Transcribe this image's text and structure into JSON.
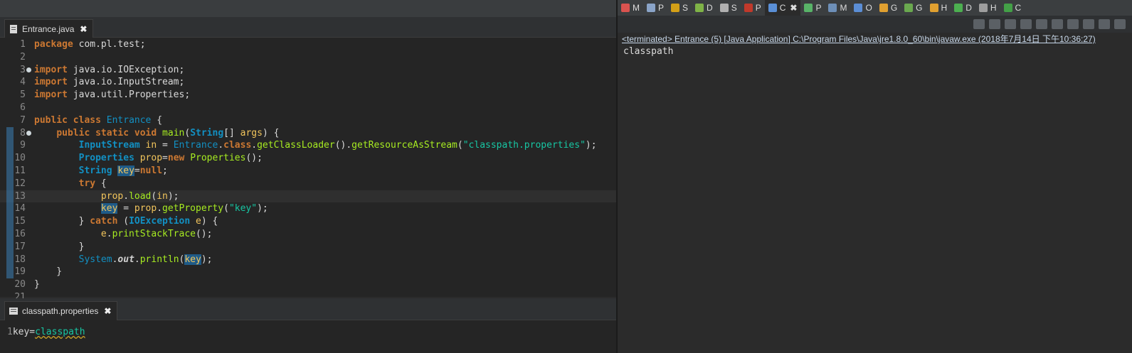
{
  "editor": {
    "tab_label": "Entrance.java",
    "lines": [
      {
        "n": "1",
        "html": "<span class='kw'>package</span> com.pl.test;"
      },
      {
        "n": "2",
        "html": ""
      },
      {
        "n": "3",
        "html": "<span class='kw'>import</span> java.io.IOException;",
        "fold": true
      },
      {
        "n": "4",
        "html": "<span class='kw'>import</span> java.io.InputStream;"
      },
      {
        "n": "5",
        "html": "<span class='kw'>import</span> java.util.Properties;"
      },
      {
        "n": "6",
        "html": ""
      },
      {
        "n": "7",
        "html": "<span class='kw'>public</span> <span class='kw'>class</span> <span class='cls'>Entrance</span> {"
      },
      {
        "n": "8",
        "html": "    <span class='kw'>public</span> <span class='kw'>static</span> <span class='kw'>void</span> <span class='fn'>main</span>(<span class='ty'>String</span>[] <span class='var'>args</span>) {",
        "fold": true
      },
      {
        "n": "9",
        "html": "        <span class='ty'>InputStream</span> <span class='var'>in</span> = <span class='cls'>Entrance</span>.<span class='kw'>class</span>.<span class='fn'>getClassLoader</span>().<span class='fn'>getResourceAsStream</span>(<span class='str'>\"classpath.properties\"</span>);"
      },
      {
        "n": "10",
        "html": "        <span class='ty'>Properties</span> <span class='var'>prop</span>=<span class='kw'>new</span> <span class='fn'>Properties</span>();"
      },
      {
        "n": "11",
        "html": "        <span class='ty'>String</span> <span class='var hl'>key</span>=<span class='kw'>null</span>;"
      },
      {
        "n": "12",
        "html": "        <span class='kw'>try</span> {"
      },
      {
        "n": "13",
        "html": "            <span class='var'>prop</span>.<span class='fn'>load</span>(<span class='var'>in</span>);",
        "current": true
      },
      {
        "n": "14",
        "html": "            <span class='var hl'>key</span> = <span class='var'>prop</span>.<span class='fn'>getProperty</span>(<span class='str'>\"key\"</span>);"
      },
      {
        "n": "15",
        "html": "        } <span class='kw'>catch</span> (<span class='ty'>IOException</span> <span class='var'>e</span>) {"
      },
      {
        "n": "16",
        "html": "            <span class='var'>e</span>.<span class='fn'>printStackTrace</span>();"
      },
      {
        "n": "17",
        "html": "        }"
      },
      {
        "n": "18",
        "html": "        <span class='cls'>System</span>.<span class='out'>out</span>.<span class='fn'>println</span>(<span class='var hl'>key</span>);"
      },
      {
        "n": "19",
        "html": "    }"
      },
      {
        "n": "20",
        "html": "}"
      },
      {
        "n": "21",
        "html": ""
      }
    ]
  },
  "props": {
    "tab_label": "classpath.properties",
    "line_number": "1",
    "key": "key=",
    "value": "classpath"
  },
  "views": {
    "tabs": [
      {
        "label": "M",
        "color": "#d9534f"
      },
      {
        "label": "P",
        "color": "#8aa4c8"
      },
      {
        "label": "S",
        "color": "#d4a017"
      },
      {
        "label": "D",
        "color": "#7fb347"
      },
      {
        "label": "S",
        "color": "#b0b0b0"
      },
      {
        "label": "P",
        "color": "#c0392b"
      },
      {
        "label": "C",
        "color": "#5a8fd6",
        "active": true
      },
      {
        "label": "P",
        "color": "#58b368"
      },
      {
        "label": "M",
        "color": "#6d8fb8"
      },
      {
        "label": "O",
        "color": "#5b8ed6"
      },
      {
        "label": "G",
        "color": "#e0a030"
      },
      {
        "label": "G",
        "color": "#6aa84f"
      },
      {
        "label": "H",
        "color": "#e0a030"
      },
      {
        "label": "D",
        "color": "#4caf50"
      },
      {
        "label": "H",
        "color": "#9e9e9e"
      },
      {
        "label": "C",
        "color": "#43a047"
      }
    ]
  },
  "console": {
    "header": "<terminated> Entrance (5) [Java Application] C:\\Program Files\\Java\\jre1.8.0_60\\bin\\javaw.exe (2018年7月14日 下午10:36:27)",
    "output": "classpath"
  }
}
